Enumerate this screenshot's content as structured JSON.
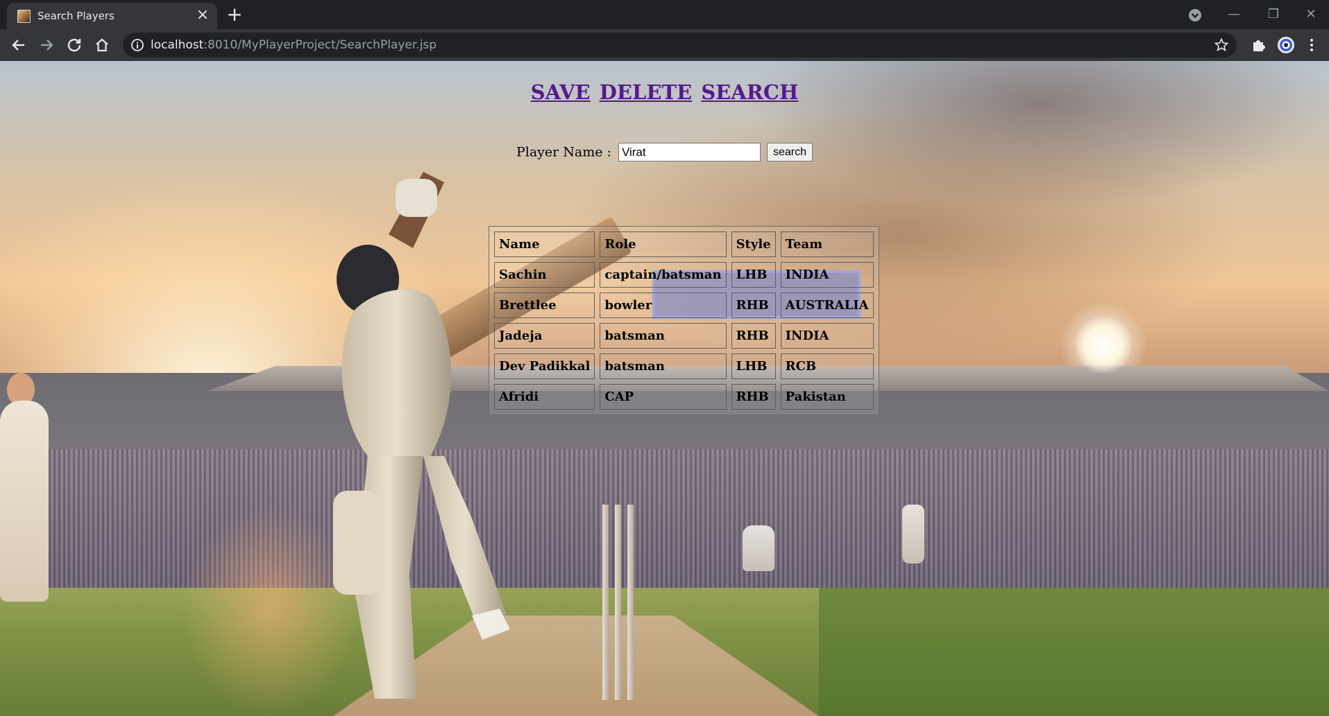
{
  "browser": {
    "tab_title": "Search Players",
    "url_host": "localhost",
    "url_rest": ":8010/MyPlayerProject/SearchPlayer.jsp"
  },
  "nav": {
    "save": "SAVE",
    "delete": "DELETE",
    "search": "SEARCH"
  },
  "search": {
    "label": "Player Name :",
    "value": "Virat",
    "button": "search"
  },
  "table": {
    "headers": [
      "Name",
      "Role",
      "Style",
      "Team"
    ],
    "rows": [
      [
        "Sachin",
        "captain/batsman",
        "LHB",
        "INDIA"
      ],
      [
        "Brettlee",
        "bowler",
        "RHB",
        "AUSTRALIA"
      ],
      [
        "Jadeja",
        "batsman",
        "RHB",
        "INDIA"
      ],
      [
        "Dev Padikkal",
        "batsman",
        "LHB",
        "RCB"
      ],
      [
        "Afridi",
        "CAP",
        "RHB",
        "Pakistan"
      ]
    ]
  },
  "colors": {
    "link": "#551a8b",
    "chrome_dark": "#202124",
    "chrome_toolbar": "#35363a"
  }
}
